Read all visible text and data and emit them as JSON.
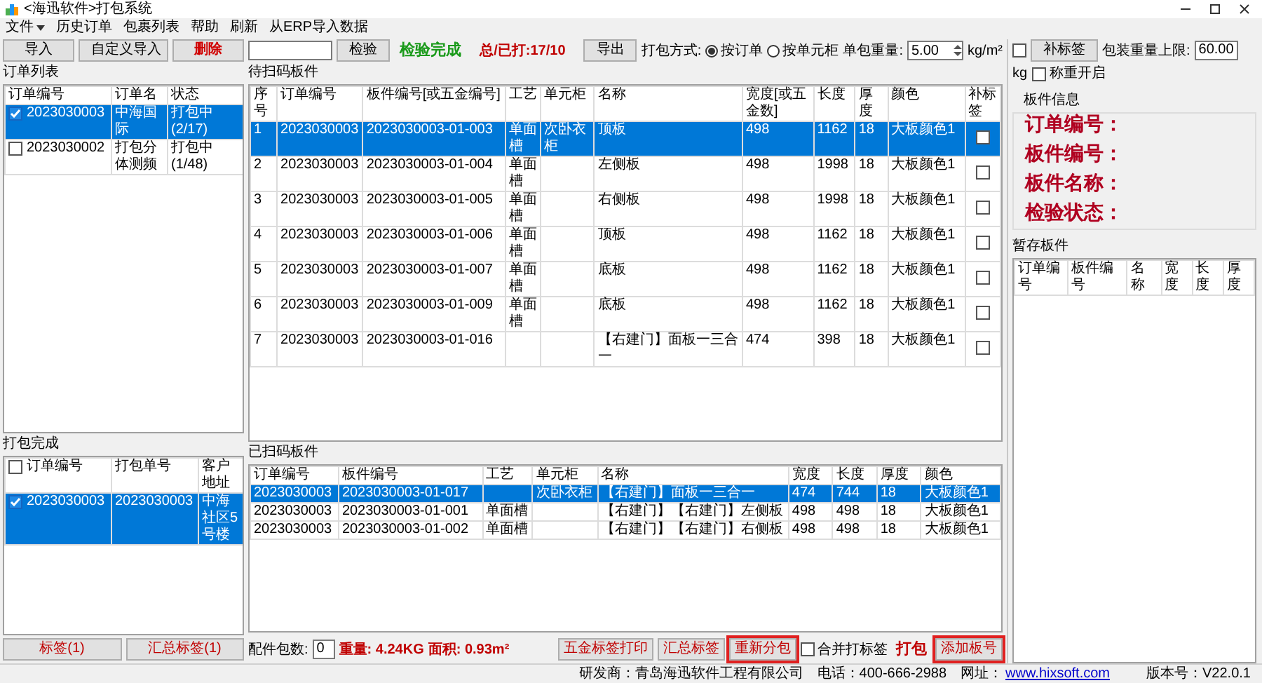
{
  "window": {
    "title": "<海迅软件>打包系统"
  },
  "menu": [
    {
      "label": "文件",
      "has_menu": true
    },
    {
      "label": "历史订单",
      "has_menu": false
    },
    {
      "label": "包裹列表",
      "has_menu": false
    },
    {
      "label": "帮助",
      "has_menu": false
    },
    {
      "label": "刷新",
      "has_menu": false
    },
    {
      "label": "从ERP导入数据",
      "has_menu": false
    }
  ],
  "order_list": {
    "buttons": [
      {
        "label": "导入",
        "kind": "normal"
      },
      {
        "label": "自定义导入",
        "kind": "normal"
      },
      {
        "label": "删除",
        "kind": "danger"
      }
    ],
    "title": "订单列表",
    "columns": [
      "订单编号",
      "订单名",
      "状态"
    ],
    "rows": [
      {
        "checked": true,
        "selected": true,
        "cells": [
          "2023030003",
          "中海国际",
          "打包中(2/17)"
        ]
      },
      {
        "checked": false,
        "selected": false,
        "cells": [
          "2023030002",
          "打包分体测频",
          "打包中(1/48)"
        ]
      }
    ]
  },
  "package_list": {
    "title": "打包完成",
    "header_checked": false,
    "columns": [
      "订单编号",
      "打包单号",
      "客户地址"
    ],
    "rows": [
      {
        "checked": true,
        "selected": true,
        "cells": [
          "2023030003",
          "2023030003",
          "中海社区5号楼"
        ]
      }
    ],
    "buttons": [
      "标签(1)",
      "汇总标签(1)"
    ]
  },
  "toolbar": {
    "check_button": "检验",
    "status": "检验完成",
    "counter": "总/已打:17/10",
    "export_button": "导出",
    "pack_mode": {
      "label": "打包方式:",
      "options": [
        {
          "label": "按订单",
          "selected": true
        },
        {
          "label": "按单元柜",
          "selected": false
        }
      ]
    },
    "unit_weight": {
      "label": "单包重量:",
      "value": "5.00",
      "unit": "kg/m²"
    }
  },
  "pending": {
    "title": "待扫码板件",
    "columns": [
      "序号",
      "订单编号",
      "板件编号[或五金编号]",
      "工艺",
      "单元柜",
      "名称",
      "宽度[或五金数]",
      "长度",
      "厚度",
      "颜色",
      "补标签"
    ],
    "rows": [
      {
        "selected": true,
        "relabel": false,
        "cells": [
          "1",
          "2023030003",
          "2023030003-01-003",
          "单面槽",
          "次卧衣柜",
          "顶板",
          "498",
          "1162",
          "18",
          "大板颜色1"
        ]
      },
      {
        "selected": false,
        "relabel": false,
        "cells": [
          "2",
          "2023030003",
          "2023030003-01-004",
          "单面槽",
          null,
          "左侧板",
          "498",
          "1998",
          "18",
          "大板颜色1"
        ]
      },
      {
        "selected": false,
        "relabel": false,
        "cells": [
          "3",
          "2023030003",
          "2023030003-01-005",
          "单面槽",
          null,
          "右侧板",
          "498",
          "1998",
          "18",
          "大板颜色1"
        ]
      },
      {
        "selected": false,
        "relabel": false,
        "cells": [
          "4",
          "2023030003",
          "2023030003-01-006",
          "单面槽",
          null,
          "顶板",
          "498",
          "1162",
          "18",
          "大板颜色1"
        ]
      },
      {
        "selected": false,
        "relabel": false,
        "cells": [
          "5",
          "2023030003",
          "2023030003-01-007",
          "单面槽",
          null,
          "底板",
          "498",
          "1162",
          "18",
          "大板颜色1"
        ]
      },
      {
        "selected": false,
        "relabel": false,
        "cells": [
          "6",
          "2023030003",
          "2023030003-01-009",
          "单面槽",
          null,
          "底板",
          "498",
          "1162",
          "18",
          "大板颜色1"
        ]
      },
      {
        "selected": false,
        "relabel": false,
        "cells": [
          "7",
          "2023030003",
          "2023030003-01-016",
          null,
          null,
          "【右建门】面板一三合一",
          "474",
          "398",
          "18",
          "大板颜色1"
        ]
      }
    ]
  },
  "scanned": {
    "title": "已扫码板件",
    "columns": [
      "订单编号",
      "板件编号",
      "工艺",
      "单元柜",
      "名称",
      "宽度",
      "长度",
      "厚度",
      "颜色"
    ],
    "rows": [
      {
        "selected": true,
        "cells": [
          "2023030003",
          "2023030003-01-017",
          null,
          "次卧衣柜",
          "【右建门】面板一三合一",
          "474",
          "744",
          "18",
          "大板颜色1"
        ]
      },
      {
        "selected": false,
        "cells": [
          "2023030003",
          "2023030003-01-001",
          "单面槽",
          null,
          "【右建门】【右建门】左侧板",
          "498",
          "498",
          "18",
          "大板颜色1"
        ]
      },
      {
        "selected": false,
        "cells": [
          "2023030003",
          "2023030003-01-002",
          "单面槽",
          null,
          "【右建门】【右建门】右侧板",
          "498",
          "498",
          "18",
          "大板颜色1"
        ]
      }
    ]
  },
  "footer": {
    "accessory_label": "配件包数:",
    "accessory_value": "0",
    "weight": "重量: 4.24KG",
    "area": "面积: 0.93m²",
    "controls": [
      {
        "kind": "button",
        "label": "五金标签打印",
        "highlighted": false
      },
      {
        "kind": "button",
        "label": "汇总标签",
        "highlighted": false
      },
      {
        "kind": "button",
        "label": "重新分包",
        "highlighted": true
      },
      {
        "kind": "checkbox",
        "label": "合并打标签",
        "checked": false
      },
      {
        "kind": "primary",
        "label": "打包",
        "highlighted": false
      },
      {
        "kind": "button",
        "label": "添加板号",
        "highlighted": true
      }
    ]
  },
  "right": {
    "relabel_checked": false,
    "relabel_button": "补标签",
    "max_weight": {
      "label": "包装重量上限:",
      "value": "60.00",
      "unit": "kg"
    },
    "weigh": {
      "label": "称重开启",
      "checked": false
    },
    "info": {
      "title": "板件信息",
      "fields": [
        "订单编号：",
        "板件编号：",
        "板件名称：",
        "检验状态："
      ]
    },
    "staging": {
      "title": "暂存板件",
      "columns": [
        "订单编号",
        "板件编号",
        "名称",
        "宽度",
        "长度",
        "厚度"
      ]
    }
  },
  "status_bar": {
    "developer": "研发商：青岛海迅软件工程有限公司",
    "phone": "电话：400-666-2988",
    "website_label": "网址：",
    "website": "www.hixsoft.com",
    "version": "版本号：V22.0.1"
  }
}
